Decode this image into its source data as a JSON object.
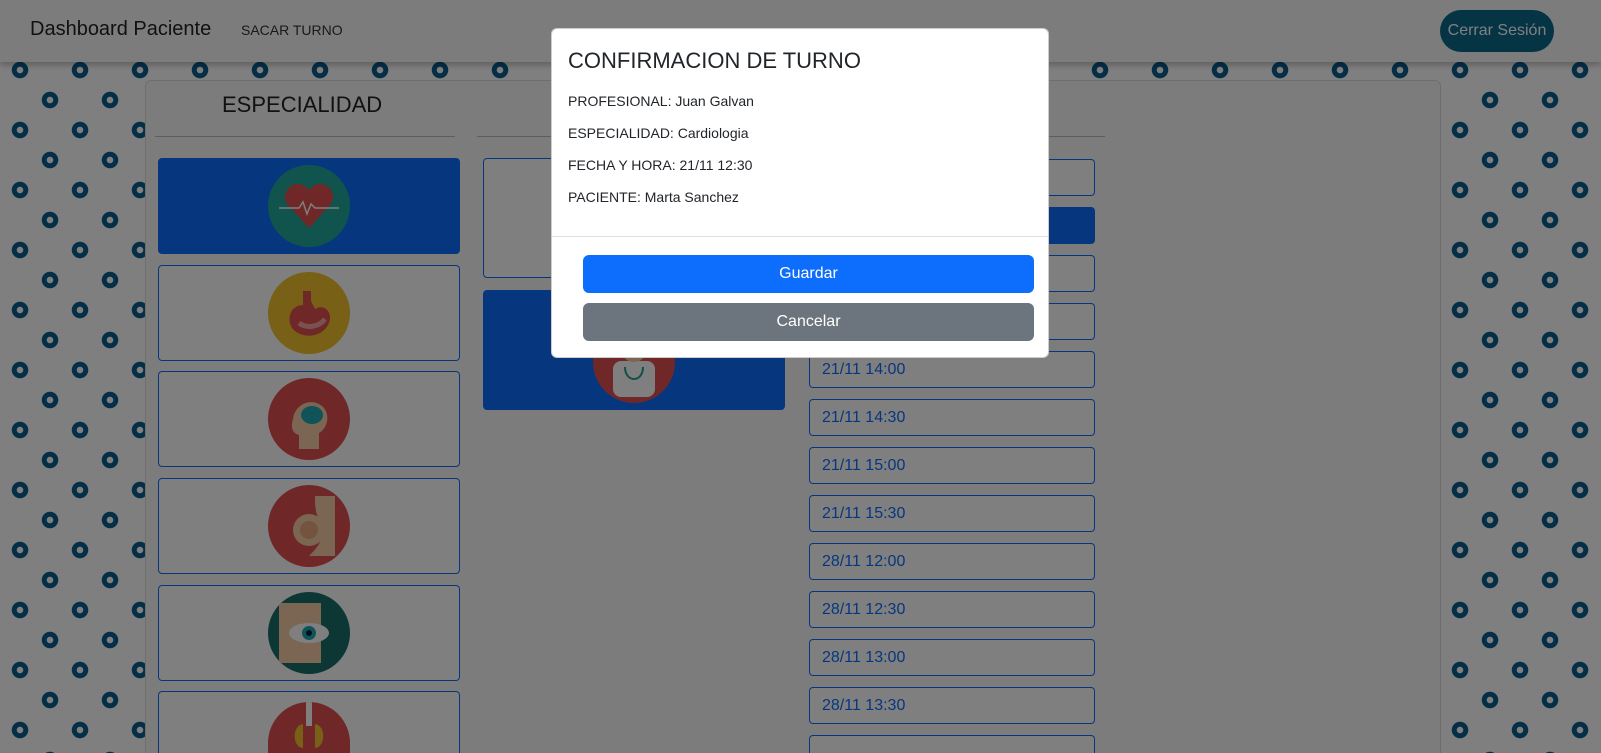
{
  "navbar": {
    "brand": "Dashboard Paciente",
    "link": "SACAR TURNO",
    "logout": "Cerrar Sesión"
  },
  "specialties": {
    "title": "ESPECIALIDAD",
    "items": [
      {
        "icon": "heart-icon",
        "color": "#20a99a",
        "active": true
      },
      {
        "icon": "stomach-icon",
        "color": "#f0c02e",
        "active": false
      },
      {
        "icon": "brain-icon",
        "color": "#e04f4f",
        "active": false
      },
      {
        "icon": "pregnancy-icon",
        "color": "#e04f4f",
        "active": false
      },
      {
        "icon": "eye-icon",
        "color": "#1b6f6a",
        "active": false
      },
      {
        "icon": "lungs-icon",
        "color": "#e04f4f",
        "active": false
      }
    ]
  },
  "doctors": [
    {
      "icon": "doctor-avatar-icon",
      "active": false
    },
    {
      "icon": "doctor-avatar-icon",
      "active": true
    }
  ],
  "slots": [
    {
      "label": "",
      "active": false
    },
    {
      "label": "",
      "active": true
    },
    {
      "label": "",
      "active": false
    },
    {
      "label": "",
      "active": false
    },
    {
      "label": "21/11 14:00",
      "active": false
    },
    {
      "label": "21/11 14:30",
      "active": false
    },
    {
      "label": "21/11 15:00",
      "active": false
    },
    {
      "label": "21/11 15:30",
      "active": false
    },
    {
      "label": "28/11 12:00",
      "active": false
    },
    {
      "label": "28/11 12:30",
      "active": false
    },
    {
      "label": "28/11 13:00",
      "active": false
    },
    {
      "label": "28/11 13:30",
      "active": false
    }
  ],
  "modal": {
    "title": "CONFIRMACION DE TURNO",
    "professional": "PROFESIONAL: Juan Galvan",
    "specialty": "ESPECIALIDAD: Cardiologia",
    "datetime": "FECHA Y HORA: 21/11 12:30",
    "patient": "PACIENTE: Marta Sanchez",
    "save": "Guardar",
    "cancel": "Cancelar"
  }
}
